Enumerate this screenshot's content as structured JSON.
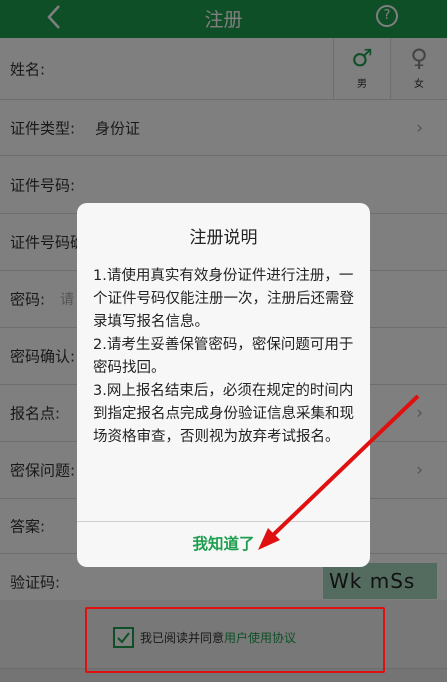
{
  "nav": {
    "title": "注册",
    "help_label": "?"
  },
  "form": {
    "name_label": "姓名:",
    "gender": {
      "male_symbol": "♂",
      "male_label": "男",
      "female_symbol": "♀",
      "female_label": "女"
    },
    "id_type_label": "证件类型:",
    "id_type_value": "身份证",
    "id_number_label": "证件号码:",
    "id_number_confirm_label": "证件号码确认:",
    "password_label": "密码:",
    "password_placeholder": "请",
    "password_confirm_label": "密码确认:",
    "exam_site_label": "报名点:",
    "security_question_label": "密保问题:",
    "answer_label": "答案:",
    "captcha_label": "验证码:",
    "captcha_text": "Wk mSs"
  },
  "agreement": {
    "text": "我已阅读并同意",
    "link": "用户使用协议"
  },
  "dialog": {
    "title": "注册说明",
    "items": [
      "1.请使用真实有效身份证件进行注册，一个证件号码仅能注册一次，注册后还需登录填写报名信息。",
      "2.请考生妥善保管密码，密保问题可用于密码找回。",
      "3.网上报名结束后，必须在规定的时间内到指定报名点完成身份验证信息采集和现场资格审查，否则视为放弃考试报名。"
    ],
    "confirm_label": "我知道了"
  },
  "colors": {
    "brand": "#1e9e4f",
    "annotation": "#e01010"
  }
}
